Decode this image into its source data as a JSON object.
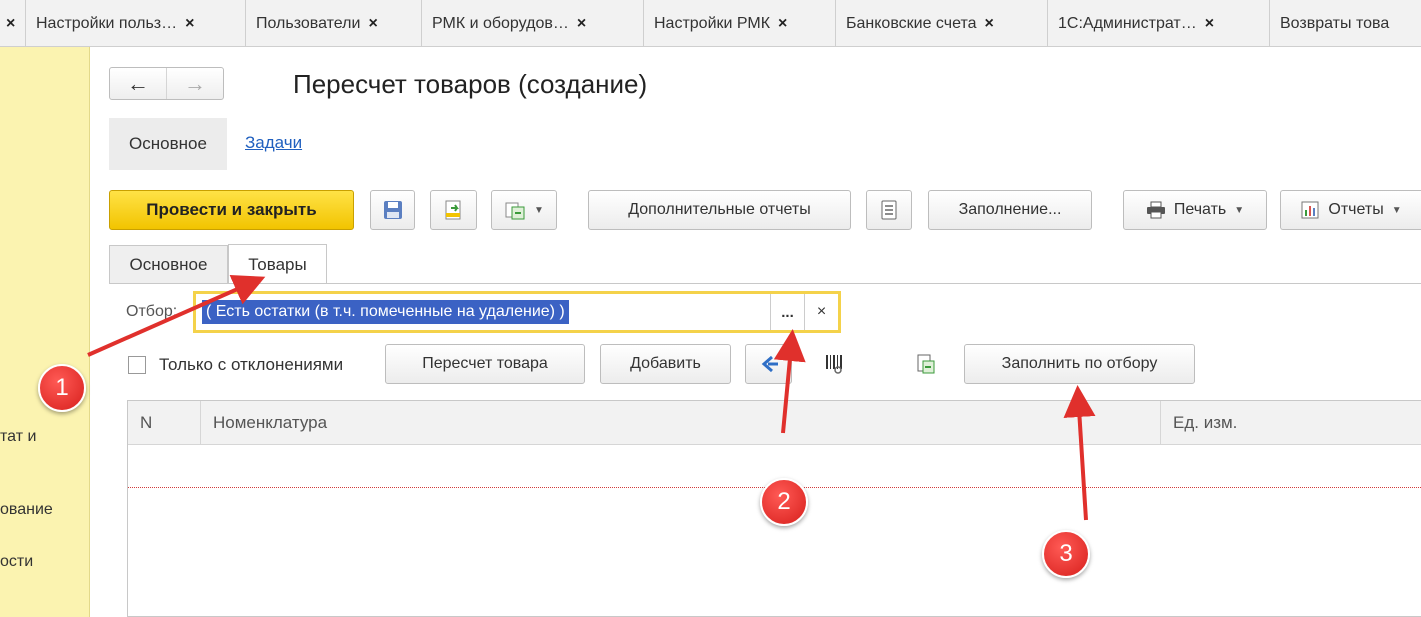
{
  "tabs": [
    {
      "label": "",
      "close": "×"
    },
    {
      "label": "Настройки польз…",
      "close": "×"
    },
    {
      "label": "Пользователи",
      "close": "×"
    },
    {
      "label": "РМК и оборудов…",
      "close": "×"
    },
    {
      "label": "Настройки РМК",
      "close": "×"
    },
    {
      "label": "Банковские счета",
      "close": "×"
    },
    {
      "label": "1С:Администрат…",
      "close": "×"
    },
    {
      "label": "Возвраты това",
      "close": ""
    }
  ],
  "sidebar": {
    "items": [
      "тат и",
      "ование",
      "ости"
    ]
  },
  "nav": {
    "back": "←",
    "forward": "→"
  },
  "page": {
    "title": "Пересчет товаров (создание)"
  },
  "sections": {
    "main": "Основное",
    "tasks": "Задачи"
  },
  "toolbar": {
    "post_close": "Провести и закрыть",
    "extra_reports": "Дополнительные отчеты",
    "fill": "Заполнение...",
    "print": "Печать",
    "reports": "Отчеты"
  },
  "inner_tabs": {
    "main": "Основное",
    "goods": "Товары"
  },
  "filter": {
    "label": "Отбор:",
    "value": "( Есть остатки (в т.ч. помеченные на удаление) )",
    "dots": "...",
    "clear": "×"
  },
  "actions": {
    "only_deviations": "Только с отклонениями",
    "recount": "Пересчет товара",
    "add": "Добавить",
    "fill_by_filter": "Заполнить по отбору"
  },
  "table": {
    "columns": [
      "N",
      "Номенклатура",
      "Ед. изм."
    ]
  },
  "annotations": [
    "1",
    "2",
    "3"
  ],
  "colors": {
    "accent_yellow": "#f5c800",
    "annotation_red": "#e0302c",
    "selection_blue": "#3b62c4"
  }
}
